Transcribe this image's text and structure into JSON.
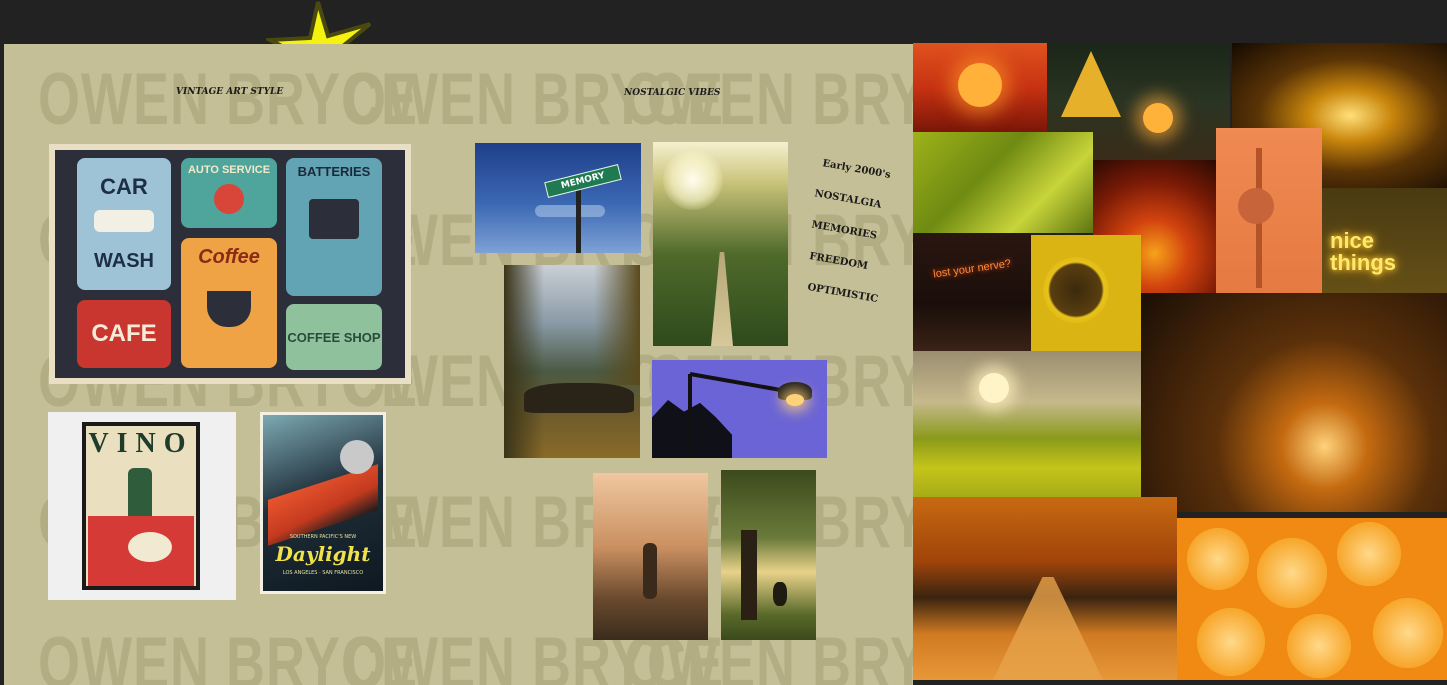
{
  "board": {
    "watermark": "OWEN BRYCE",
    "section_left_title": "VINTAGE ART STYLE",
    "section_center_title": "NOSTALGIC VIBES",
    "keywords": [
      "Early 2000's",
      "NOSTALGIA",
      "MEMORIES",
      "FREEDOM",
      "OPTIMISTIC"
    ]
  },
  "signs": {
    "car_wash_top": "CAR",
    "car_wash_bottom": "WASH",
    "auto_service": "AUTO SERVICE",
    "batteries": "BATTERIES",
    "coffee": "Coffee",
    "cafe": "CAFE",
    "coffee_shop": "COFFEE SHOP",
    "vino": "VINO",
    "daylight_small": "SOUTHERN PACIFIC'S NEW",
    "daylight": "Daylight",
    "daylight_route": "LOS ANGELES · SAN FRANCISCO",
    "street_sign": "MEMORY",
    "neon_sign": "nice things",
    "neon_sign_small": "lost your nerve?"
  },
  "colors": {
    "board_bg": "#c4bf96",
    "page_bg": "#222222",
    "star_fill": "#f4f20e",
    "star_stroke": "#4a4a10"
  }
}
